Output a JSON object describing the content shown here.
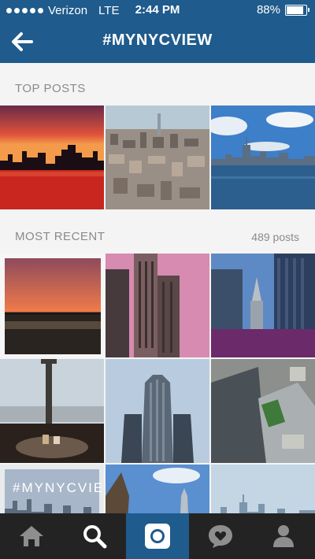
{
  "status_bar": {
    "carrier": "Verizon",
    "network": "LTE",
    "time": "2:44 PM",
    "battery": "88%"
  },
  "header": {
    "title": "#MYNYCVIEW"
  },
  "top_posts": {
    "label": "TOP POSTS"
  },
  "most_recent": {
    "label": "MOST RECENT",
    "count": "489 posts"
  },
  "overlay_text": "#MYNYCVIEW",
  "tabs": [
    "home-icon",
    "search-icon",
    "camera-icon",
    "activity-icon",
    "profile-icon"
  ],
  "colors": {
    "brand": "#1f5b8c",
    "tabbar": "#232323",
    "active_tab": "#1f5b8c"
  }
}
